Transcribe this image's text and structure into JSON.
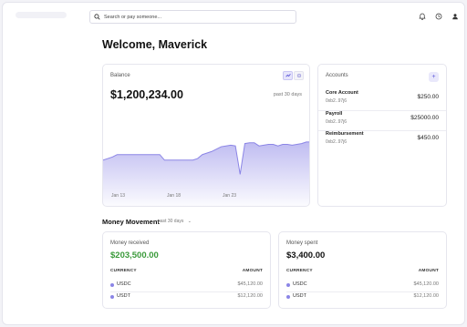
{
  "search": {
    "placeholder": "Search or pay someone..."
  },
  "header": {
    "title": "Welcome, Maverick"
  },
  "balance": {
    "label": "Balance",
    "amount": "$1,200,234.00",
    "range": "past 30 days",
    "toggle_chart_icon": "chart-line-icon",
    "toggle_settings_icon": "settings-icon",
    "x_ticks": [
      "Jan 13",
      "Jan 18",
      "Jan 23"
    ],
    "accent": "#8b85e6"
  },
  "chart_data": {
    "type": "area",
    "title": "",
    "xlabel": "",
    "ylabel": "",
    "x": [
      0,
      1,
      2,
      3,
      4,
      5,
      6,
      7,
      8,
      9,
      10,
      11,
      12,
      13,
      14,
      15,
      16,
      17,
      18,
      19,
      20,
      21,
      22,
      23,
      24,
      25,
      26,
      27,
      28,
      29,
      30,
      31,
      32,
      33,
      34,
      35,
      36,
      37,
      38,
      39,
      40,
      41,
      42,
      43,
      44
    ],
    "values": [
      58,
      60,
      62,
      65,
      65,
      65,
      65,
      65,
      65,
      65,
      65,
      65,
      65,
      58,
      58,
      58,
      58,
      58,
      58,
      58,
      60,
      65,
      67,
      69,
      72,
      75,
      76,
      77,
      76,
      40,
      79,
      80,
      80,
      76,
      77,
      78,
      78,
      76,
      78,
      78,
      77,
      78,
      79,
      81,
      81
    ],
    "ylim": [
      0,
      100
    ],
    "x_ticks": [
      "Jan 13",
      "Jan 18",
      "Jan 23"
    ],
    "grid": false,
    "color": "#8b85e6"
  },
  "accounts": {
    "label": "Accounts",
    "add_icon": "plus-icon",
    "items": [
      {
        "name": "Core Account",
        "address": "0xb2..97j6",
        "balance": "$250.00"
      },
      {
        "name": "Payroll",
        "address": "0xb2..97j6",
        "balance": "$25000.00"
      },
      {
        "name": "Reimbursement",
        "address": "0xb2..97j6",
        "balance": "$450.00"
      }
    ]
  },
  "money_movement": {
    "title": "Money Movement",
    "range": "past 30 days",
    "received": {
      "label": "Money received",
      "amount": "$203,500.00",
      "amount_color": "#3a9a3a",
      "col_currency": "CURRENCY",
      "col_amount": "AMOUNT",
      "rows": [
        {
          "currency": "USDC",
          "amount": "$45,120.00"
        },
        {
          "currency": "USDT",
          "amount": "$12,120.00"
        }
      ]
    },
    "spent": {
      "label": "Money spent",
      "amount": "$3,400.00",
      "amount_color": "#111111",
      "col_currency": "CURRENCY",
      "col_amount": "AMOUNT",
      "rows": [
        {
          "currency": "USDC",
          "amount": "$45,120.00"
        },
        {
          "currency": "USDT",
          "amount": "$12,120.00"
        }
      ]
    }
  },
  "icons": {
    "search": "search-icon",
    "notifications": "bell-icon",
    "clock": "clock-icon",
    "profile": "user-icon"
  }
}
